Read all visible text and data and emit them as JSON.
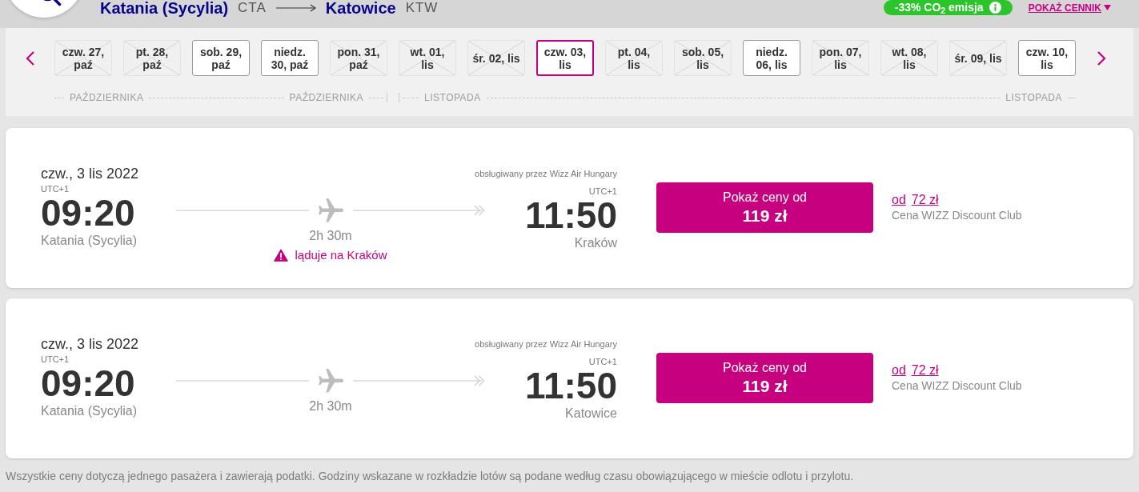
{
  "header": {
    "origin": {
      "city": "Katania (Sycylia)",
      "code": "CTA"
    },
    "destination": {
      "city": "Katowice",
      "code": "KTW"
    },
    "co2_badge": "-33% CO$_{2}$ emisja",
    "price_list_link": "POKAŻ CENNIK"
  },
  "date_strip": {
    "months": [
      {
        "start_label": "PAŹDZIERNIKA",
        "end_label": "PAŹDZIERNIKA",
        "days": [
          {
            "lines": [
              "czw. 27,",
              "paź"
            ],
            "disabled": true,
            "selected": false
          },
          {
            "lines": [
              "pt. 28,",
              "paź"
            ],
            "disabled": true,
            "selected": false
          },
          {
            "lines": [
              "sob. 29,",
              "paź"
            ],
            "disabled": false,
            "selected": false
          },
          {
            "lines": [
              "niedz.",
              "30, paź"
            ],
            "disabled": false,
            "selected": false
          },
          {
            "lines": [
              "pon. 31,",
              "paź"
            ],
            "disabled": true,
            "selected": false
          }
        ]
      },
      {
        "start_label": "LISTOPADA",
        "end_label": "LISTOPADA",
        "days": [
          {
            "lines": [
              "wt. 01,",
              "lis"
            ],
            "disabled": true,
            "selected": false
          },
          {
            "lines": [
              "śr. 02, lis"
            ],
            "disabled": true,
            "selected": false
          },
          {
            "lines": [
              "czw. 03,",
              "lis"
            ],
            "disabled": false,
            "selected": true
          },
          {
            "lines": [
              "pt. 04,",
              "lis"
            ],
            "disabled": true,
            "selected": false
          },
          {
            "lines": [
              "sob. 05,",
              "lis"
            ],
            "disabled": true,
            "selected": false
          },
          {
            "lines": [
              "niedz.",
              "06, lis"
            ],
            "disabled": false,
            "selected": false
          },
          {
            "lines": [
              "pon. 07,",
              "lis"
            ],
            "disabled": true,
            "selected": false
          },
          {
            "lines": [
              "wt. 08,",
              "lis"
            ],
            "disabled": true,
            "selected": false
          },
          {
            "lines": [
              "śr. 09, lis"
            ],
            "disabled": true,
            "selected": false
          },
          {
            "lines": [
              "czw. 10,",
              "lis"
            ],
            "disabled": false,
            "selected": false
          }
        ]
      }
    ]
  },
  "flights": [
    {
      "date": "czw., 3 lis 2022",
      "operator": "obsługiwany przez Wizz Air Hungary",
      "departure": {
        "timezone": "UTC+1",
        "time": "09:20",
        "city": "Katania (Sycylia)"
      },
      "arrival": {
        "timezone": "UTC+1",
        "time": "11:50",
        "city": "Kraków"
      },
      "duration": "2h 30m",
      "warning": "ląduje na Kraków",
      "price_button": {
        "label": "Pokaż ceny od",
        "price": "119 zł"
      },
      "club_price": {
        "prefix": "od",
        "price": "72 zł",
        "label": "Cena WIZZ Discount Club"
      }
    },
    {
      "date": "czw., 3 lis 2022",
      "operator": "obsługiwany przez Wizz Air Hungary",
      "departure": {
        "timezone": "UTC+1",
        "time": "09:20",
        "city": "Katania (Sycylia)"
      },
      "arrival": {
        "timezone": "UTC+1",
        "time": "11:50",
        "city": "Katowice"
      },
      "duration": "2h 30m",
      "price_button": {
        "label": "Pokaż ceny od",
        "price": "119 zł"
      },
      "club_price": {
        "prefix": "od",
        "price": "72 zł",
        "label": "Cena WIZZ Discount Club"
      }
    }
  ],
  "footer_note": "Wszystkie ceny dotyczą jednego pasażera i zawierają podatki. Godziny wskazane w rozkładzie lotów są podane według czasu obowiązującego w mieście odlotu i przylotu."
}
